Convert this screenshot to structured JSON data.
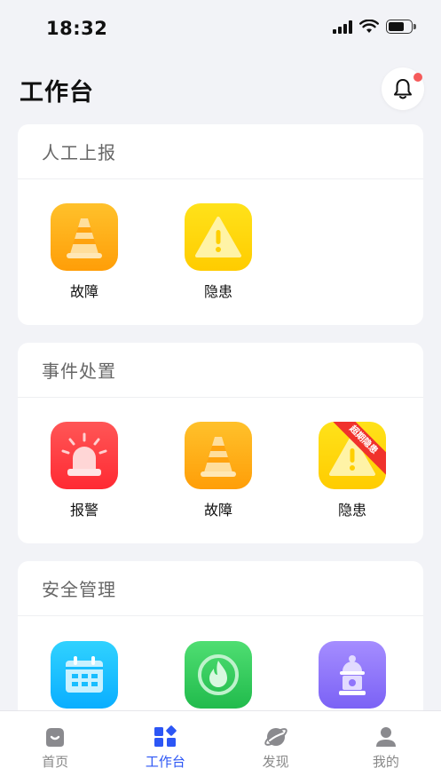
{
  "status_bar": {
    "time": "18:32"
  },
  "header": {
    "title": "工作台",
    "bell_icon": "bell-icon",
    "has_notification": true
  },
  "sections": {
    "report": {
      "title": "人工上报",
      "items": [
        {
          "label": "故障",
          "icon": "traffic-cone-icon",
          "color": "#ffa914"
        },
        {
          "label": "隐患",
          "icon": "warning-triangle-icon",
          "color": "#ffd60a"
        }
      ]
    },
    "incident": {
      "title": "事件处置",
      "items": [
        {
          "label": "报警",
          "icon": "alarm-siren-icon",
          "color": "#ff3b3f"
        },
        {
          "label": "故障",
          "icon": "traffic-cone-icon",
          "color": "#ffa914"
        },
        {
          "label": "隐患",
          "icon": "warning-triangle-icon",
          "color": "#ffd60a",
          "badge": "超期隐患"
        }
      ]
    },
    "safety": {
      "title": "安全管理",
      "items": [
        {
          "label": "",
          "icon": "calendar-icon",
          "color": "#18bdff"
        },
        {
          "label": "",
          "icon": "fire-icon",
          "color": "#33cc5c"
        },
        {
          "label": "",
          "icon": "fire-hydrant-icon",
          "color": "#8f74fb"
        }
      ]
    }
  },
  "tabbar": {
    "items": [
      {
        "label": "首页",
        "icon": "home-icon",
        "active": false
      },
      {
        "label": "工作台",
        "icon": "workbench-icon",
        "active": true
      },
      {
        "label": "发现",
        "icon": "planet-icon",
        "active": false
      },
      {
        "label": "我的",
        "icon": "user-icon",
        "active": false
      }
    ],
    "active_color": "#2c56f5"
  }
}
